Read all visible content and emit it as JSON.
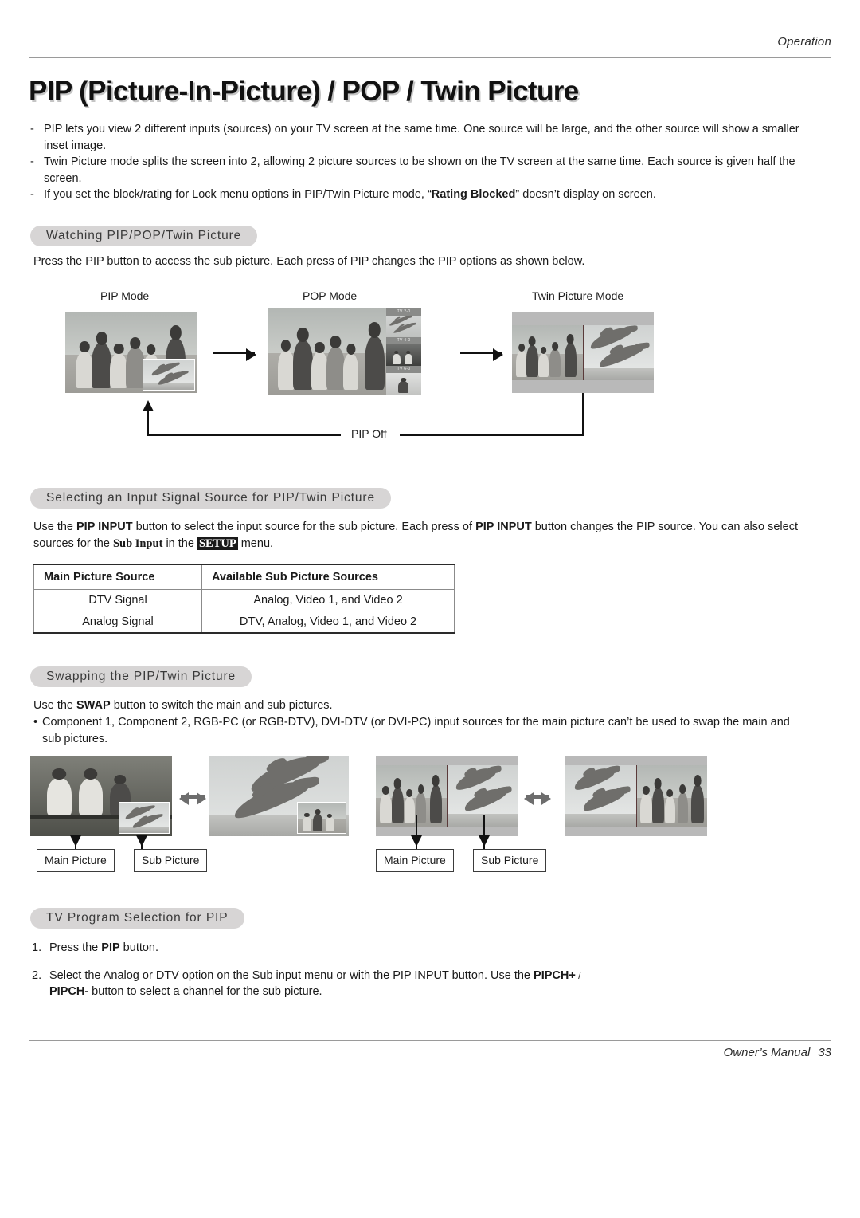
{
  "header": {
    "section_label": "Operation"
  },
  "title": "PIP (Picture-In-Picture) / POP / Twin Picture",
  "intro": {
    "dash": "-",
    "bullets": [
      "PIP lets you view 2 different inputs (sources) on your TV screen at the same time. One source will be large, and the other source will show a smaller inset image.",
      "Twin Picture mode splits the screen into 2, allowing 2 picture sources to be shown on the TV screen at the same time. Each source is given half the screen.",
      "If you set the block/rating for Lock menu options in PIP/Twin Picture mode, “Rating Blocked” doesn’t display on screen."
    ],
    "bullet3_prefix": "If you set the block/rating for Lock menu options in PIP/Twin Picture mode, “",
    "bullet3_bold": "Rating Blocked",
    "bullet3_suffix": "” doesn’t display on screen."
  },
  "sections": {
    "watching": {
      "heading": "Watching PIP/POP/Twin Picture",
      "paragraph": "Press the PIP button to access the sub picture. Each press of PIP changes the PIP options as shown below.",
      "mode_captions": [
        "PIP Mode",
        "POP Mode",
        "Twin Picture Mode"
      ],
      "loop_label": "PIP Off",
      "pop_channels": [
        "TV 2-0",
        "TV 4-0",
        "TV 6-0"
      ]
    },
    "selecting": {
      "heading": "Selecting an Input Signal Source for PIP/Twin Picture",
      "para_1a": "Use the ",
      "para_1b": "PIP INPUT",
      "para_1c": " button to select the input source for the sub picture. Each press of ",
      "para_1d": "PIP INPUT",
      "para_1e": " button changes the PIP source. You can also select sources for the ",
      "para_1f": "Sub Input",
      "para_1g": " in the ",
      "para_1h": "SETUP",
      "para_1i": " menu.",
      "table": {
        "columns": [
          "Main Picture Source",
          "Available Sub Picture Sources"
        ],
        "rows": [
          [
            "DTV Signal",
            "Analog, Video 1, and Video 2"
          ],
          [
            "Analog Signal",
            "DTV, Analog, Video 1, and Video 2"
          ]
        ]
      }
    },
    "swapping": {
      "heading": "Swapping the PIP/Twin Picture",
      "para_1a": "Use the ",
      "para_1b": "SWAP",
      "para_1c": " button to switch the main and sub pictures.",
      "bullet_dot": "•",
      "para_2": "Component 1, Component 2, RGB-PC (or RGB-DTV), DVI-DTV (or DVI-PC) input sources for the main picture can’t be used to swap the main and sub pictures.",
      "labels": {
        "main": "Main Picture",
        "sub": "Sub Picture"
      }
    },
    "tvprogram": {
      "heading": "TV Program Selection for PIP",
      "steps": [
        {
          "num": "1.",
          "a": "Press the ",
          "b": "PIP",
          "c": " button."
        },
        {
          "num": "2.",
          "a": "Select the Analog or DTV option on the Sub input menu or with the PIP INPUT button. Use the ",
          "b": "PIPCH+",
          "c": " / ",
          "d": "PIPCH-",
          "e": " button to select a channel for the sub picture."
        }
      ]
    }
  },
  "footer": {
    "text": "Owner’s Manual",
    "page": "33"
  },
  "colors": {
    "pill_background": "#d7d5d5",
    "rule": "#9a9a9a",
    "text": "#1a1a1a",
    "tv_frame": "#b9b9b9"
  }
}
